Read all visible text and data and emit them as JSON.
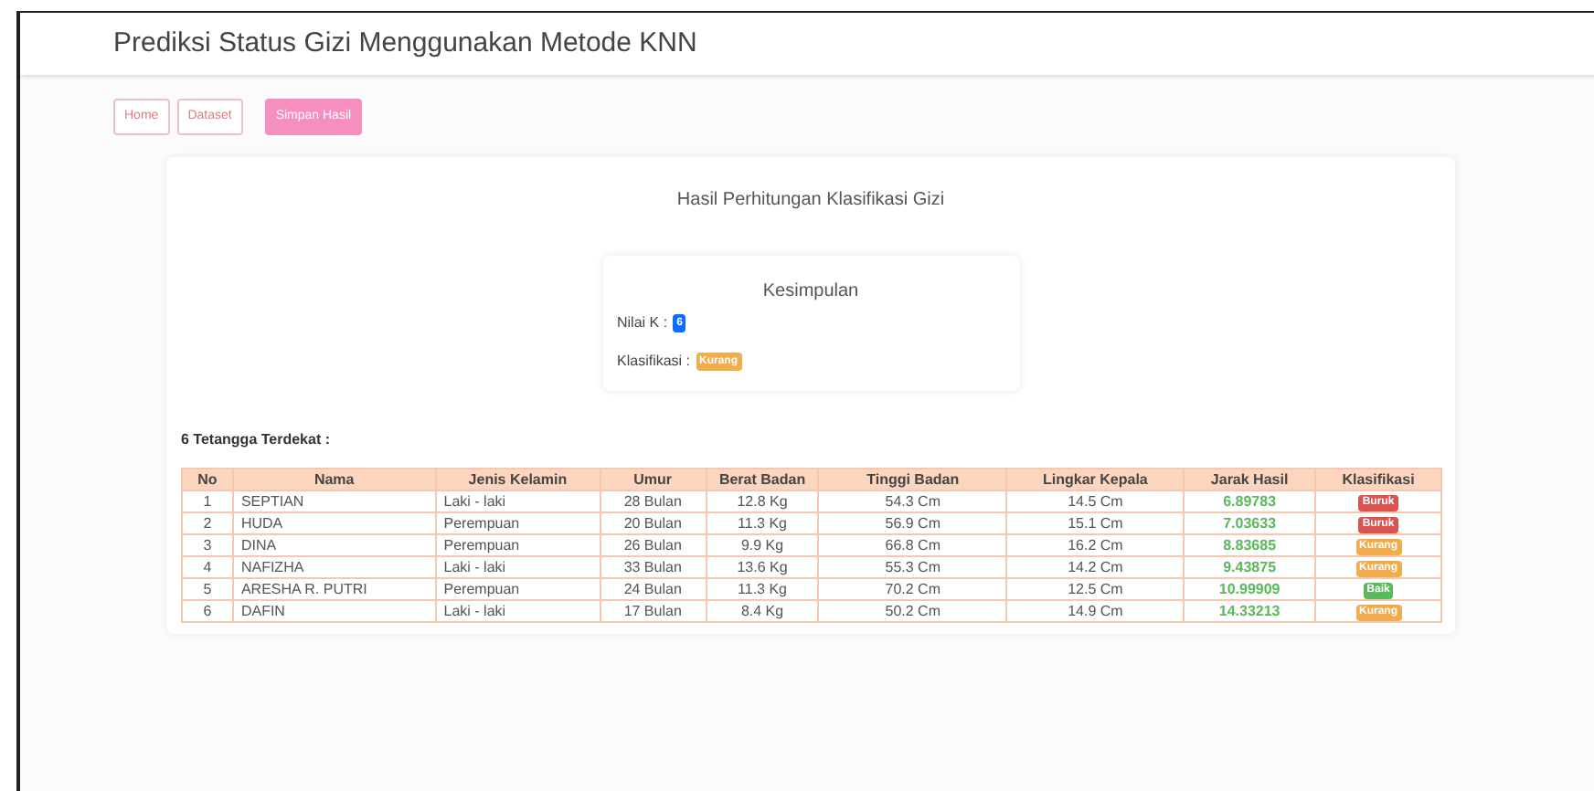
{
  "header": {
    "title": "Prediksi Status Gizi Menggunakan Metode KNN"
  },
  "nav_buttons": [
    {
      "label": "Home",
      "kind": "outline"
    },
    {
      "label": "Dataset",
      "kind": "outline"
    },
    {
      "label": "Simpan Hasil",
      "kind": "filled"
    }
  ],
  "card": {
    "title": "Hasil Perhitungan Klasifikasi Gizi",
    "conclusion": {
      "title": "Kesimpulan",
      "k_label": "Nilai K :",
      "k_value": "6",
      "class_label": "Klasifikasi :",
      "class_value": "Kurang",
      "color": "#f0ad4e"
    },
    "neighbors_title": "6 Tetangga Terdekat :",
    "table": {
      "columns": [
        "No",
        "Nama",
        "Jenis Kelamin",
        "Umur",
        "Berat Badan",
        "Tinggi Badan",
        "Lingkar Kepala",
        "Jarak Hasil",
        "Klasifikasi"
      ],
      "rows": [
        {
          "no": "1",
          "nama": "SEPTIAN",
          "jenis_kelamin": "Laki - laki",
          "umur": "28 Bulan",
          "berat": "12.8 Kg",
          "tinggi": "54.3 Cm",
          "lingkar": "14.5 Cm",
          "jarak": "6.89783",
          "klasifikasi": "Buruk",
          "color": "#d9534f"
        },
        {
          "no": "2",
          "nama": "HUDA",
          "jenis_kelamin": "Perempuan",
          "umur": "20 Bulan",
          "berat": "11.3 Kg",
          "tinggi": "56.9 Cm",
          "lingkar": "15.1 Cm",
          "jarak": "7.03633",
          "klasifikasi": "Buruk",
          "color": "#d9534f"
        },
        {
          "no": "3",
          "nama": "DINA",
          "jenis_kelamin": "Perempuan",
          "umur": "26 Bulan",
          "berat": "9.9 Kg",
          "tinggi": "66.8 Cm",
          "lingkar": "16.2 Cm",
          "jarak": "8.83685",
          "klasifikasi": "Kurang",
          "color": "#f0ad4e"
        },
        {
          "no": "4",
          "nama": "NAFIZHA",
          "jenis_kelamin": "Laki - laki",
          "umur": "33 Bulan",
          "berat": "13.6 Kg",
          "tinggi": "55.3 Cm",
          "lingkar": "14.2 Cm",
          "jarak": "9.43875",
          "klasifikasi": "Kurang",
          "color": "#f0ad4e"
        },
        {
          "no": "5",
          "nama": "ARESHA R. PUTRI",
          "jenis_kelamin": "Perempuan",
          "umur": "24 Bulan",
          "berat": "11.3 Kg",
          "tinggi": "70.2 Cm",
          "lingkar": "12.5 Cm",
          "jarak": "10.99909",
          "klasifikasi": "Baik",
          "color": "#5cb85c"
        },
        {
          "no": "6",
          "nama": "DAFIN",
          "jenis_kelamin": "Laki - laki",
          "umur": "17 Bulan",
          "berat": "8.4 Kg",
          "tinggi": "50.2 Cm",
          "lingkar": "14.9 Cm",
          "jarak": "14.33213",
          "klasifikasi": "Kurang",
          "color": "#f0ad4e"
        }
      ]
    }
  }
}
